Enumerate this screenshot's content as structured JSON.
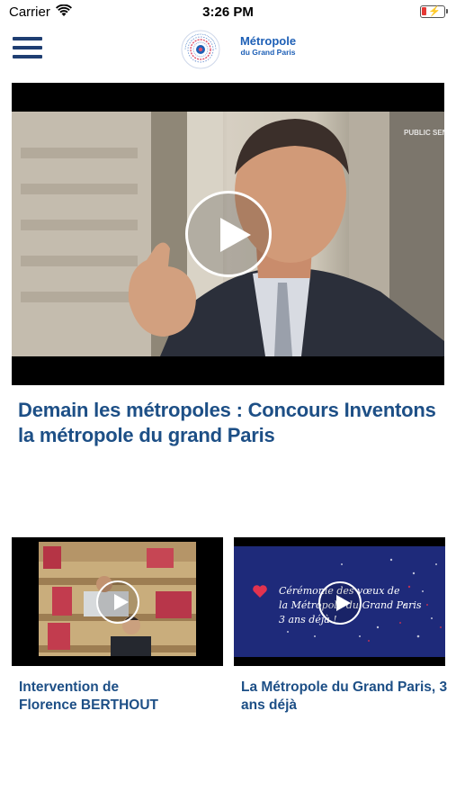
{
  "status_bar": {
    "carrier": "Carrier",
    "time": "3:26 PM",
    "battery_color": "#e53935"
  },
  "header": {
    "menu_icon": "hamburger-menu-icon",
    "logo_title": "Métropole",
    "logo_subtitle": "du Grand Paris",
    "brand_color": "#1d5fb6"
  },
  "featured": {
    "title": "Demain les métropoles : Concours Inventons la métropole du grand Paris",
    "watermark": "PUBLIC SENAT",
    "play_icon": "play-icon"
  },
  "cards": [
    {
      "title_line1": "Intervention de",
      "title_line2": "Florence BERTHOUT",
      "play_icon": "play-icon"
    },
    {
      "title_line1": "La Métropole du Grand Paris, 3",
      "title_line2": "ans déjà",
      "overlay_line1": "Cérémonie des vœux de",
      "overlay_line2": "la Métropole du Grand Paris",
      "overlay_line3": "3 ans déjà !",
      "play_icon": "play-icon"
    }
  ],
  "colors": {
    "title_text": "#1d4f86",
    "video_bg": "#000000",
    "ceremony_bg": "#1e2a7a"
  }
}
